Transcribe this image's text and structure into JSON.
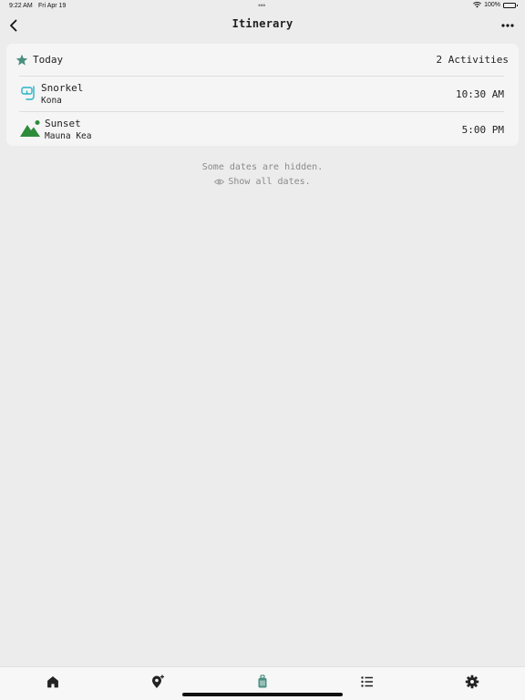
{
  "status_bar": {
    "time": "9:22 AM",
    "date": "Fri Apr 19",
    "dots": "•••",
    "battery": "100%"
  },
  "nav": {
    "title": "Itinerary",
    "back_icon": "chevron-left-icon",
    "more_icon": "ellipsis-icon"
  },
  "section": {
    "title": "Today",
    "count": "2 Activities",
    "icon": "star-icon",
    "activities": [
      {
        "name": "Snorkel",
        "location": "Kona",
        "time": "10:30 AM",
        "icon": "snorkel-mask-icon"
      },
      {
        "name": "Sunset",
        "location": "Mauna Kea",
        "time": "5:00 PM",
        "icon": "mountain-sun-icon"
      }
    ]
  },
  "hidden_dates": {
    "message": "Some dates are hidden.",
    "action": "Show all dates."
  },
  "tabs": [
    {
      "name": "home",
      "icon": "house-icon"
    },
    {
      "name": "add-place",
      "icon": "map-pin-plus-icon"
    },
    {
      "name": "itinerary",
      "icon": "suitcase-icon",
      "active": true
    },
    {
      "name": "list",
      "icon": "list-icon"
    },
    {
      "name": "settings",
      "icon": "gear-icon"
    }
  ],
  "colors": {
    "accent": "#4a8f80",
    "snorkel": "#2ab3c7",
    "mountain": "#2e8b3a",
    "background": "#ececec",
    "card": "#f5f5f5"
  }
}
